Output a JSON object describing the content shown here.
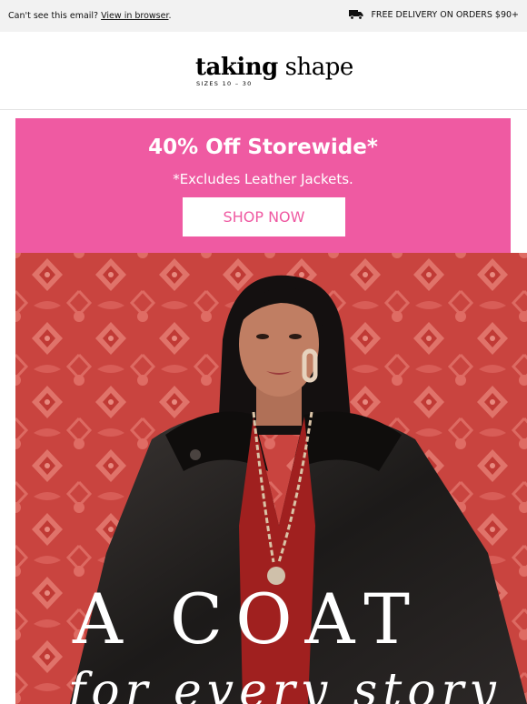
{
  "preheader": {
    "cant_see": "Can't see this email?",
    "view_link": "View in browser",
    "period": ".",
    "delivery": "FREE DELIVERY ON ORDERS $90+",
    "delivery_icon": "truck-icon"
  },
  "header": {
    "logo_part1": "taking",
    "logo_part2": "shape",
    "logo_sizes": "SIZES 10 – 30"
  },
  "banner": {
    "title": "40% Off Storewide*",
    "subtitle": "*Excludes Leather Jackets.",
    "button_label": "SHOP NOW",
    "color": "#ef5aa2"
  },
  "hero": {
    "headline": "A COAT",
    "script_line": "for every story",
    "background_color": "#c6463f"
  }
}
